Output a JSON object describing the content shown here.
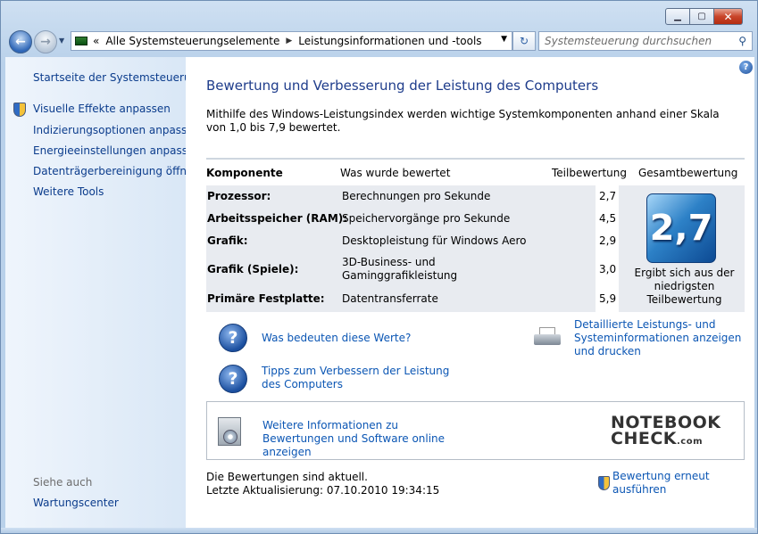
{
  "window": {
    "address": {
      "overflow": "«",
      "crumbs": [
        "Alle Systemsteuerungselemente",
        "Leistungsinformationen und -tools"
      ]
    },
    "search_placeholder": "Systemsteuerung durchsuchen"
  },
  "sidebar": {
    "home": "Startseite der Systemsteuerung",
    "items": [
      "Visuelle Effekte anpassen",
      "Indizierungsoptionen anpassen",
      "Energieeinstellungen anpassen",
      "Datenträgerbereinigung öffnen",
      "Weitere Tools"
    ],
    "see_also_label": "Siehe auch",
    "see_also_items": [
      "Wartungscenter"
    ]
  },
  "main": {
    "title": "Bewertung und Verbesserung der Leistung des Computers",
    "intro": "Mithilfe des Windows-Leistungsindex werden wichtige Systemkomponenten anhand einer Skala von 1,0 bis 7,9 bewertet.",
    "table": {
      "headers": [
        "Komponente",
        "Was wurde bewertet",
        "Teilbewertung",
        "Gesamtbewertung"
      ],
      "rows": [
        {
          "component": "Prozessor:",
          "rated": "Berechnungen pro Sekunde",
          "score": "2,7"
        },
        {
          "component": "Arbeitsspeicher (RAM):",
          "rated": "Speichervorgänge pro Sekunde",
          "score": "4,5"
        },
        {
          "component": "Grafik:",
          "rated": "Desktopleistung für Windows Aero",
          "score": "2,9"
        },
        {
          "component": "Grafik (Spiele):",
          "rated": "3D-Business- und Gaminggrafikleistung",
          "score": "3,0"
        },
        {
          "component": "Primäre Festplatte:",
          "rated": "Datentransferrate",
          "score": "5,9"
        }
      ],
      "base_score": "2,7",
      "base_score_note": "Ergibt sich aus der niedrigsten Teilbewertung"
    },
    "links": {
      "what_mean": "Was bedeuten diese Werte?",
      "tips": "Tipps zum Verbessern der Leistung des Computers",
      "details": "Detaillierte Leistungs- und Systeminformationen anzeigen und drucken",
      "more_info": "Weitere Informationen zu Bewertungen und Software online anzeigen",
      "rerun": "Bewertung erneut ausführen"
    },
    "watermark": {
      "line1": "NOTEBOOK",
      "line2": "CHECK",
      "suffix": ".com"
    },
    "status": {
      "current": "Die Bewertungen sind aktuell.",
      "last_update": "Letzte Aktualisierung: 07.10.2010 19:34:15"
    }
  }
}
